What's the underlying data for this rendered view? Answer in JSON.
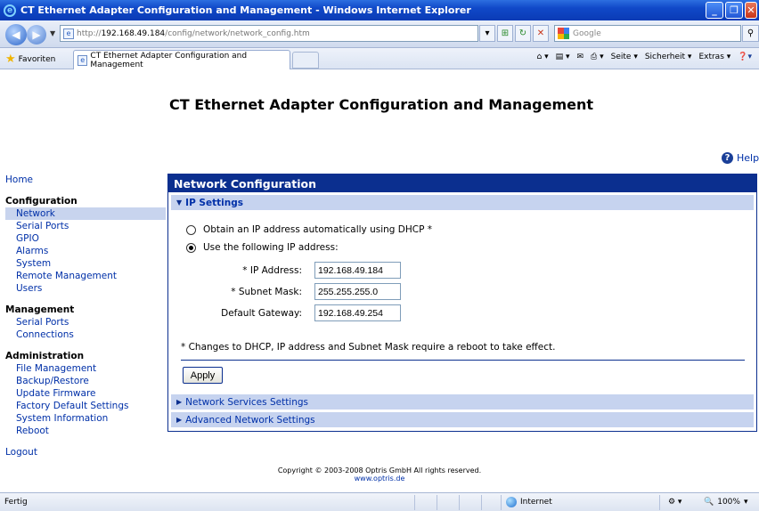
{
  "window": {
    "title": "CT Ethernet Adapter Configuration and Management - Windows Internet Explorer"
  },
  "address": {
    "url_prefix": "http://",
    "url_host": "192.168.49.184",
    "url_path": "/config/network/network_config.htm",
    "search_placeholder": "Google"
  },
  "favbar": {
    "favorites_label": "Favoriten",
    "tab_title": "CT Ethernet Adapter Configuration and Management",
    "tools": [
      "Seite ▾",
      "Sicherheit ▾",
      "Extras ▾"
    ]
  },
  "page": {
    "title": "CT Ethernet Adapter Configuration and Management",
    "help_label": "Help"
  },
  "sidebar": {
    "home": "Home",
    "configuration": {
      "heading": "Configuration",
      "items": [
        "Network",
        "Serial Ports",
        "GPIO",
        "Alarms",
        "System",
        "Remote Management",
        "Users"
      ]
    },
    "management": {
      "heading": "Management",
      "items": [
        "Serial Ports",
        "Connections"
      ]
    },
    "administration": {
      "heading": "Administration",
      "items": [
        "File Management",
        "Backup/Restore",
        "Update Firmware",
        "Factory Default Settings",
        "System Information",
        "Reboot"
      ]
    },
    "logout": "Logout"
  },
  "panel": {
    "heading": "Network Configuration",
    "ip_section": "IP Settings",
    "dhcp_option": "Obtain an IP address automatically using DHCP *",
    "static_option": "Use the following IP address:",
    "ip_label": "* IP Address:",
    "ip_value": "192.168.49.184",
    "mask_label": "* Subnet Mask:",
    "mask_value": "255.255.255.0",
    "gateway_label": "Default Gateway:",
    "gateway_value": "192.168.49.254",
    "note": "* Changes to DHCP, IP address and Subnet Mask require a reboot to take effect.",
    "apply_label": "Apply",
    "services_section": "Network Services Settings",
    "advanced_section": "Advanced Network Settings"
  },
  "footer": {
    "copyright": "Copyright © 2003-2008 Optris GmbH All rights reserved.",
    "link": "www.optris.de"
  },
  "status": {
    "text": "Fertig",
    "zone": "Internet",
    "zoom": "100%"
  },
  "colors": {
    "panel_header": "#0b2f8f",
    "section_bar": "#c6d3ef",
    "link": "#0030a8"
  }
}
